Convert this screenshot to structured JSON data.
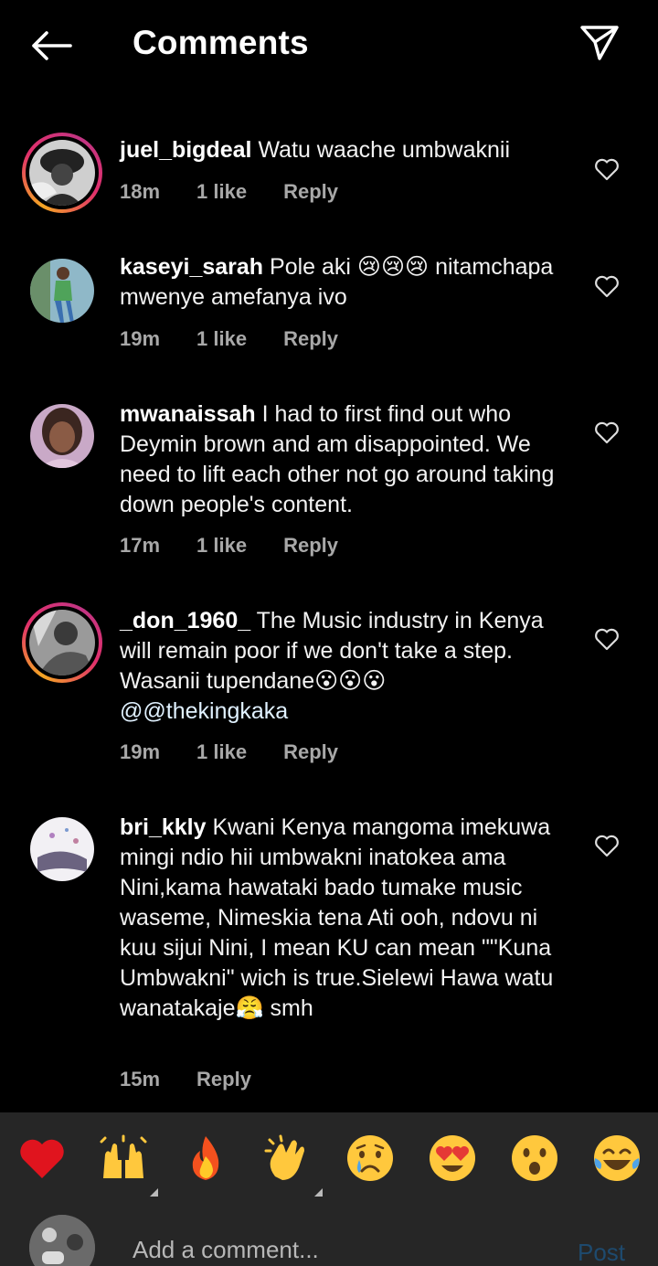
{
  "header": {
    "title": "Comments"
  },
  "comments": [
    {
      "username": "juel_bigdeal",
      "text": "Watu waache umbwaknii",
      "time": "18m",
      "likes": "1 like",
      "reply": "Reply"
    },
    {
      "username": "kaseyi_sarah",
      "text": "Pole aki 😢😢😢 nitamchapa mwenye amefanya ivo",
      "time": "19m",
      "likes": "1 like",
      "reply": "Reply"
    },
    {
      "username": "mwanaissah",
      "text": "I had to first find out who Deymin brown and am disappointed. We need to lift each other not go around taking down people's content.",
      "time": "17m",
      "likes": "1 like",
      "reply": "Reply"
    },
    {
      "username": "_don_1960_",
      "text": "The Music industry in Kenya will remain poor if we don't take a step. Wasanii tupendane😮😮😮",
      "mention": "@@thekingkaka",
      "time": "19m",
      "likes": "1 like",
      "reply": "Reply"
    },
    {
      "username": "bri_kkly",
      "text": "Kwani Kenya mangoma imekuwa mingi ndio hii umbwakni inatokea ama Nini,kama hawataki bado tumake music waseme, Nimeskia tena Ati ooh, ndovu ni kuu sijui Nini, I mean KU can mean \"\"Kuna Umbwakni\" wich is true.Sielewi Hawa watu wanatakaje😤 smh",
      "time": "15m",
      "reply": "Reply"
    }
  ],
  "reactions": [
    "heart",
    "raised-hands",
    "fire",
    "clapping-hands",
    "crying-face",
    "heart-eyes",
    "surprised-face",
    "tears-of-joy"
  ],
  "composer": {
    "placeholder": "Add a comment...",
    "post_label": "Post"
  },
  "colors": {
    "background": "#000000",
    "bar": "#262626",
    "post_disabled": "#1e4a6e",
    "meta": "#a8a8a8"
  }
}
